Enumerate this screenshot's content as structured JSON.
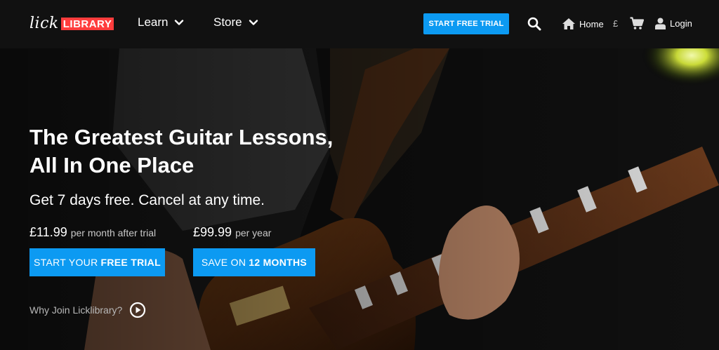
{
  "nav": {
    "logo_lick": "lick",
    "logo_library": "LIBRARY",
    "learn_label": "Learn",
    "store_label": "Store",
    "trial_button": "START FREE TRIAL",
    "home_label": "Home",
    "currency_symbol": "£",
    "login_label": "Login",
    "icons": [
      "chevron-down-icon",
      "search-icon",
      "home-icon",
      "cart-icon",
      "user-icon"
    ]
  },
  "hero": {
    "headline_line1": "The Greatest Guitar Lessons,",
    "headline_line2": "All In One Place",
    "subheadline": "Get 7 days free. Cancel at any time.",
    "monthly_price": "£11.99",
    "monthly_note": "per month after trial",
    "yearly_price": "£99.99",
    "yearly_note": "per year",
    "cta_trial_prefix": "START YOUR",
    "cta_trial_bold": "FREE TRIAL",
    "cta_save_prefix": "SAVE ON",
    "cta_save_bold": "12 MONTHS",
    "why_join": "Why Join Licklibrary?"
  },
  "colors": {
    "accent_blue": "#0c9af2",
    "logo_red": "#ff3d3d",
    "nav_bg": "#111111"
  }
}
